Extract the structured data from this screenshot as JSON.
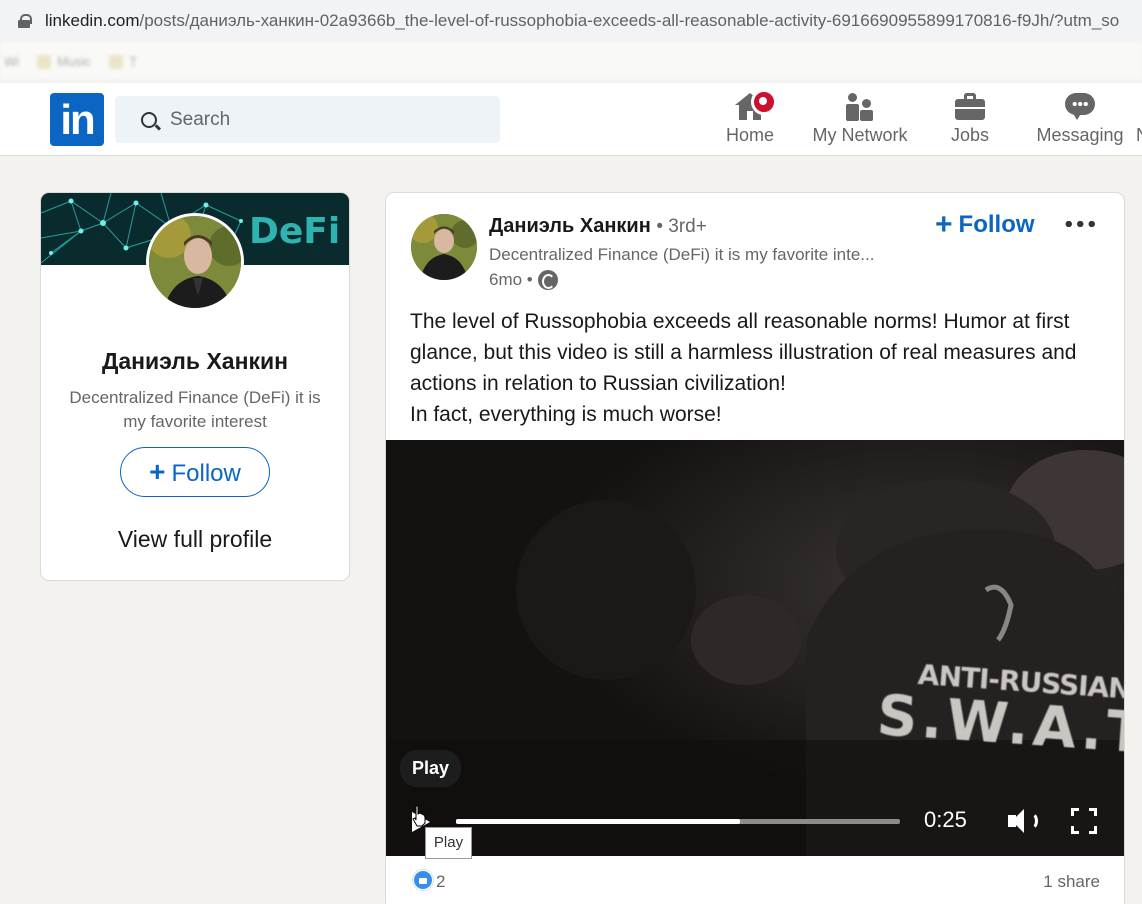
{
  "browser": {
    "url_domain": "linkedin.com",
    "url_path": "/posts/даниэль-ханкин-02a9366b_the-level-of-russophobia-exceeds-all-reasonable-activity-6916690955899170816-f9Jh/?utm_so",
    "bookmarks": [
      "Wi",
      "Music",
      "T"
    ]
  },
  "nav": {
    "logo": "in",
    "search_placeholder": "Search",
    "items": [
      {
        "label": "Home",
        "icon": "home-icon"
      },
      {
        "label": "My Network",
        "icon": "network-icon"
      },
      {
        "label": "Jobs",
        "icon": "briefcase-icon"
      },
      {
        "label": "Messaging",
        "icon": "messaging-icon"
      }
    ],
    "cut_item": "N"
  },
  "profile_card": {
    "banner_text": "DeFi",
    "name": "Даниэль Ханкин",
    "headline": "Decentralized Finance (DeFi) it is my favorite interest",
    "follow_label": "Follow",
    "view_profile": "View full profile"
  },
  "post": {
    "author": "Даниэль Ханкин",
    "degree": "• 3rd+",
    "headline": "Decentralized Finance (DeFi) it is my favorite inte...",
    "time": "6mo •",
    "follow_label": "Follow",
    "text_lines": [
      "The level of Russophobia exceeds all reasonable norms! Humor at first glance, but this video is still a harmless illustration of real measures and actions in relation to Russian civilization!",
      "In fact, everything is much worse!"
    ],
    "video": {
      "overlay_line1": "ANTI-RUSSIAN",
      "overlay_line2": "S.W.A.T.",
      "play_tooltip": "Play",
      "hover_tooltip": "Play",
      "time": "0:25",
      "progress": 0.64
    },
    "likes": "2",
    "shares": "1 share"
  },
  "colors": {
    "brand": "#0a66c2",
    "notification": "#cb112d",
    "page_bg": "#f3f2ef"
  }
}
